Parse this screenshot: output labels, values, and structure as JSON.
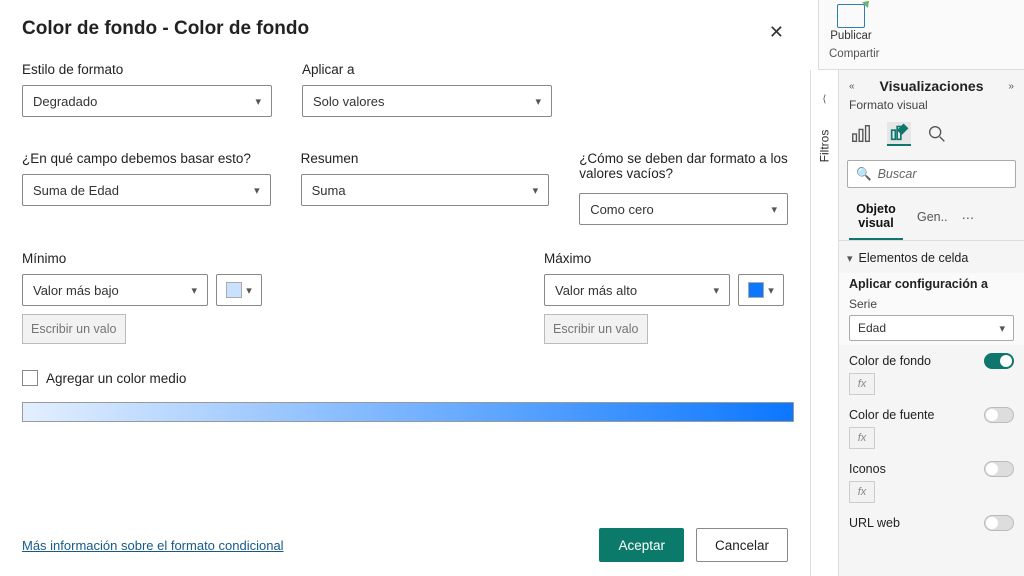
{
  "dialog": {
    "title": "Color de fondo - Color de fondo",
    "format_style_label": "Estilo de formato",
    "format_style_value": "Degradado",
    "apply_to_label": "Aplicar a",
    "apply_to_value": "Solo valores",
    "base_field_label": "¿En qué campo debemos basar esto?",
    "base_field_value": "Suma de Edad",
    "summary_label": "Resumen",
    "summary_value": "Suma",
    "empty_label": "¿Cómo se deben dar formato a los valores vacíos?",
    "empty_value": "Como cero",
    "min_label": "Mínimo",
    "min_value": "Valor más bajo",
    "min_color": "#c9e0ff",
    "min_placeholder": "Escribir un valor",
    "max_label": "Máximo",
    "max_value": "Valor más alto",
    "max_color": "#0b77ff",
    "max_placeholder": "Escribir un valor",
    "mid_checkbox_label": "Agregar un color medio",
    "link": "Más información sobre el formato condicional",
    "accept": "Aceptar",
    "cancel": "Cancelar"
  },
  "ribbon": {
    "publish": "Publicar",
    "share": "Compartir"
  },
  "panel": {
    "title": "Visualizaciones",
    "subtitle": "Formato visual",
    "search_placeholder": "Buscar",
    "tab_visual": "Objeto visual",
    "tab_general": "Gen..",
    "group_header": "Elementos de celda",
    "apply_to_label": "Aplicar configuración a",
    "series_label": "Serie",
    "series_value": "Edad",
    "props": {
      "bg": "Color de fondo",
      "font": "Color de fuente",
      "icons": "Iconos",
      "url": "URL web"
    },
    "fx": "fx"
  },
  "sidebar": {
    "filters": "Filtros"
  }
}
